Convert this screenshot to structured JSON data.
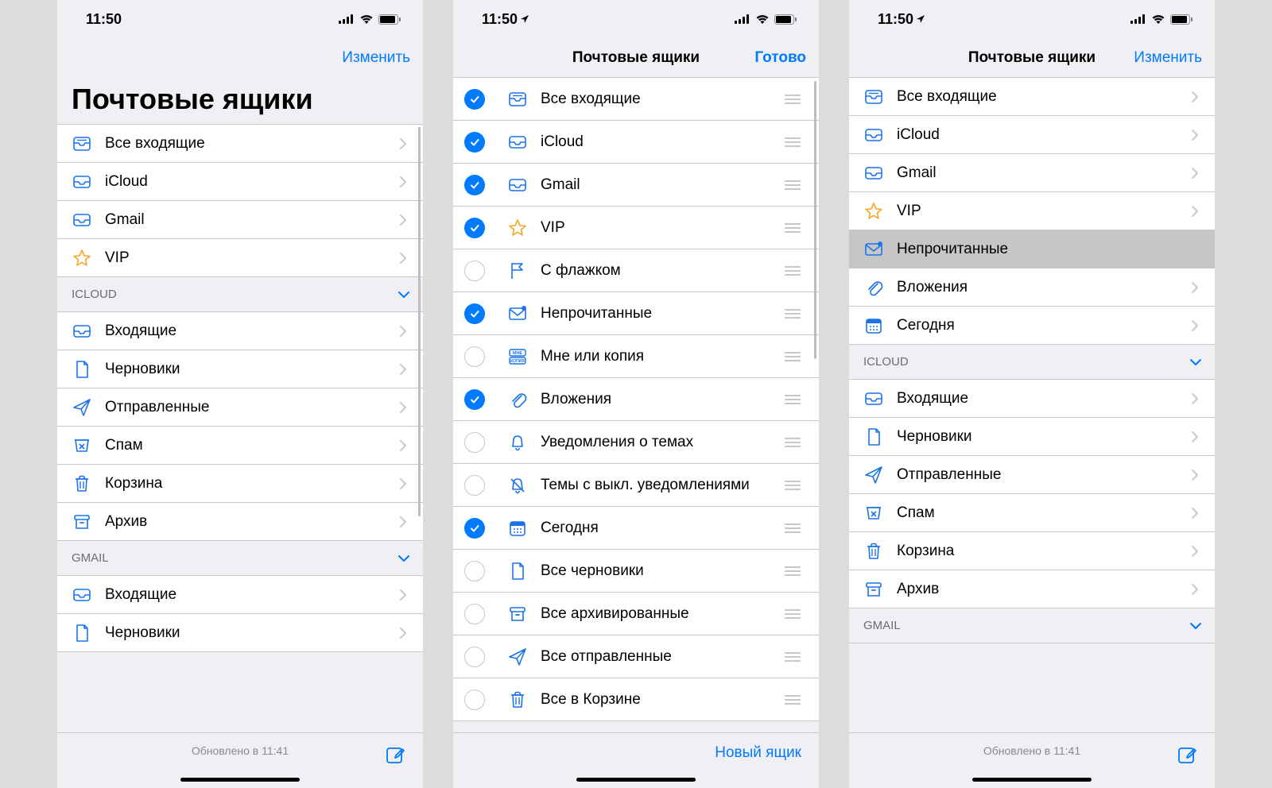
{
  "status": {
    "time": "11:50",
    "time_loc": "11:50"
  },
  "nav": {
    "title": "Почтовые ящики",
    "edit": "Изменить",
    "done": "Готово"
  },
  "large_title": "Почтовые ящики",
  "toolbar": {
    "updated": "Обновлено в 11:41",
    "new_mailbox": "Новый ящик"
  },
  "screen1": {
    "top": [
      {
        "icon": "inbox-all",
        "label": "Все входящие"
      },
      {
        "icon": "inbox",
        "label": "iCloud"
      },
      {
        "icon": "inbox",
        "label": "Gmail"
      },
      {
        "icon": "star",
        "label": "VIP"
      }
    ],
    "section_icloud": "iCloud",
    "icloud": [
      {
        "icon": "inbox",
        "label": "Входящие"
      },
      {
        "icon": "doc",
        "label": "Черновики"
      },
      {
        "icon": "send",
        "label": "Отправленные"
      },
      {
        "icon": "spam",
        "label": "Спам"
      },
      {
        "icon": "trash",
        "label": "Корзина"
      },
      {
        "icon": "archive",
        "label": "Архив"
      }
    ],
    "section_gmail": "Gmail",
    "gmail": [
      {
        "icon": "inbox",
        "label": "Входящие"
      },
      {
        "icon": "doc",
        "label": "Черновики"
      }
    ]
  },
  "screen2": {
    "items": [
      {
        "checked": true,
        "icon": "inbox-all",
        "label": "Все входящие"
      },
      {
        "checked": true,
        "icon": "inbox",
        "label": "iCloud"
      },
      {
        "checked": true,
        "icon": "inbox",
        "label": "Gmail"
      },
      {
        "checked": true,
        "icon": "star",
        "label": "VIP"
      },
      {
        "checked": false,
        "icon": "flag",
        "label": "С флажком"
      },
      {
        "checked": true,
        "icon": "unread",
        "label": "Непрочитанные"
      },
      {
        "checked": false,
        "icon": "tocc",
        "label": "Мне или копия"
      },
      {
        "checked": true,
        "icon": "attach",
        "label": "Вложения"
      },
      {
        "checked": false,
        "icon": "bell",
        "label": "Уведомления о темах"
      },
      {
        "checked": false,
        "icon": "bell-off",
        "label": "Темы с выкл. уведомлениями"
      },
      {
        "checked": true,
        "icon": "today",
        "label": "Сегодня"
      },
      {
        "checked": false,
        "icon": "doc",
        "label": "Все черновики"
      },
      {
        "checked": false,
        "icon": "archive",
        "label": "Все архивированные"
      },
      {
        "checked": false,
        "icon": "send",
        "label": "Все отправленные"
      },
      {
        "checked": false,
        "icon": "trash",
        "label": "Все в Корзине"
      }
    ]
  },
  "screen3": {
    "top": [
      {
        "icon": "inbox-all",
        "label": "Все входящие"
      },
      {
        "icon": "inbox",
        "label": "iCloud"
      },
      {
        "icon": "inbox",
        "label": "Gmail"
      },
      {
        "icon": "star",
        "label": "VIP"
      },
      {
        "icon": "unread",
        "label": "Непрочитанные",
        "highlight": true
      },
      {
        "icon": "attach",
        "label": "Вложения"
      },
      {
        "icon": "today",
        "label": "Сегодня"
      }
    ],
    "section_icloud": "iCloud",
    "icloud": [
      {
        "icon": "inbox",
        "label": "Входящие"
      },
      {
        "icon": "doc",
        "label": "Черновики"
      },
      {
        "icon": "send",
        "label": "Отправленные"
      },
      {
        "icon": "spam",
        "label": "Спам"
      },
      {
        "icon": "trash",
        "label": "Корзина"
      },
      {
        "icon": "archive",
        "label": "Архив"
      }
    ],
    "section_gmail": "Gmail"
  }
}
